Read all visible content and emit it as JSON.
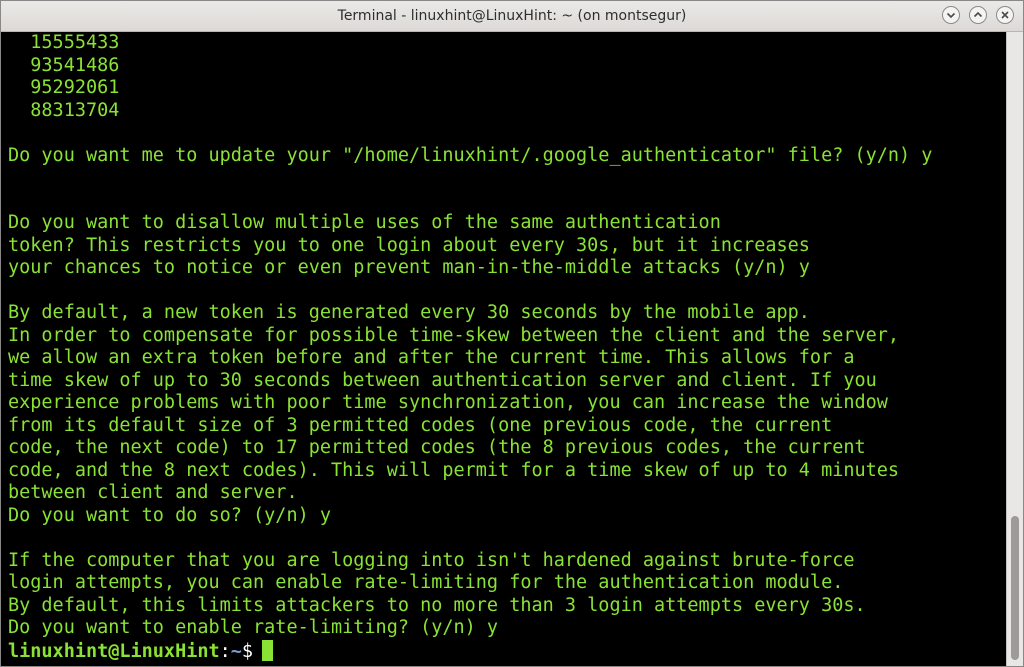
{
  "window": {
    "title": "Terminal - linuxhint@LinuxHint: ~ (on montsegur)",
    "buttons": [
      {
        "name": "minimize",
        "icon": "minimize-icon"
      },
      {
        "name": "maximize",
        "icon": "maximize-icon"
      },
      {
        "name": "close",
        "icon": "close-icon"
      }
    ]
  },
  "colors": {
    "terminal_text": "#8ae234",
    "terminal_background": "#000000",
    "prompt_path": "#729fcf"
  },
  "terminal": {
    "lines": [
      "  15555433",
      "  93541486",
      "  95292061",
      "  88313704",
      "",
      "Do you want me to update your \"/home/linuxhint/.google_authenticator\" file? (y/n) y",
      "",
      "",
      "Do you want to disallow multiple uses of the same authentication",
      "token? This restricts you to one login about every 30s, but it increases",
      "your chances to notice or even prevent man-in-the-middle attacks (y/n) y",
      "",
      "By default, a new token is generated every 30 seconds by the mobile app.",
      "In order to compensate for possible time-skew between the client and the server,",
      "we allow an extra token before and after the current time. This allows for a",
      "time skew of up to 30 seconds between authentication server and client. If you",
      "experience problems with poor time synchronization, you can increase the window",
      "from its default size of 3 permitted codes (one previous code, the current",
      "code, the next code) to 17 permitted codes (the 8 previous codes, the current",
      "code, and the 8 next codes). This will permit for a time skew of up to 4 minutes",
      "between client and server.",
      "Do you want to do so? (y/n) y",
      "",
      "If the computer that you are logging into isn't hardened against brute-force",
      "login attempts, you can enable rate-limiting for the authentication module.",
      "By default, this limits attackers to no more than 3 login attempts every 30s.",
      "Do you want to enable rate-limiting? (y/n) y"
    ],
    "prompt": {
      "user_host": "linuxhint@LinuxHint",
      "separator": ":",
      "path": "~",
      "symbol": "$"
    }
  }
}
